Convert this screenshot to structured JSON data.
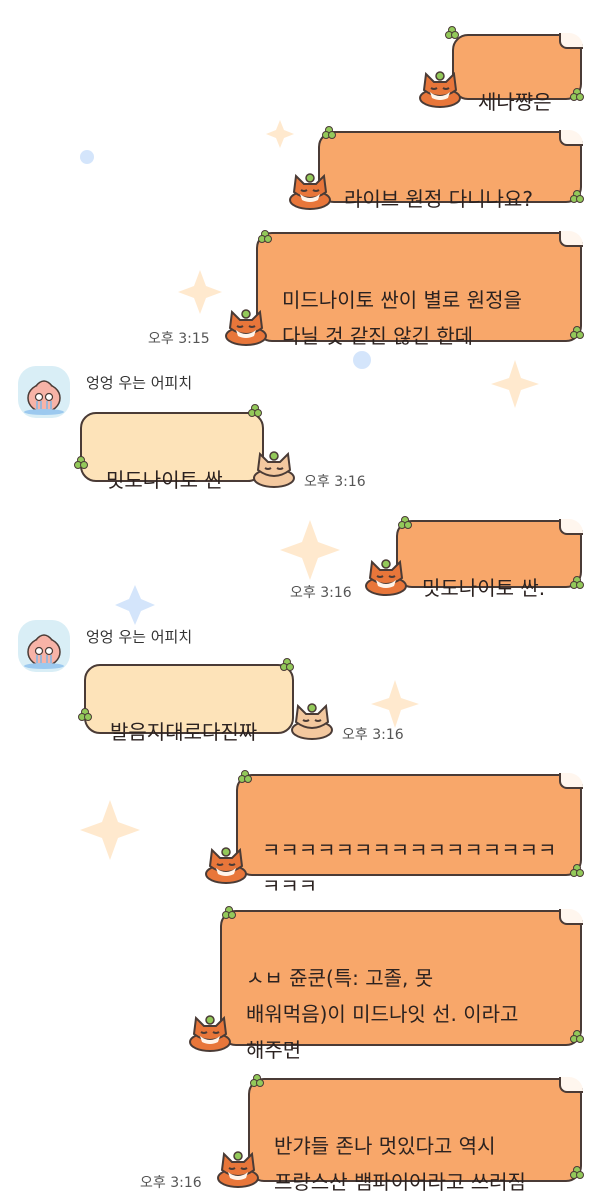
{
  "colors": {
    "outgoing_bubble": "#f8a76a",
    "incoming_bubble": "#fde3b9",
    "bubble_border": "#4a3b36",
    "clover": "#93c95a",
    "background": "#ffffff"
  },
  "messages": [
    {
      "id": "m1",
      "direction": "out",
      "text": "세나쨩은",
      "time": ""
    },
    {
      "id": "m2",
      "direction": "out",
      "text": "라이브 원정 다니나요?",
      "time": ""
    },
    {
      "id": "m3",
      "direction": "out",
      "text": "미드나이토 싼이 별로 원정을\n다닐 것 같진 않긴 한데",
      "time": "오후 3:15"
    },
    {
      "id": "m4",
      "direction": "in",
      "sender": "엉엉 우는 어피치",
      "text": "밋도나이토 싼",
      "time": "오후 3:16"
    },
    {
      "id": "m5",
      "direction": "out",
      "text": "밋도나이토 싼.",
      "time": "오후 3:16"
    },
    {
      "id": "m6",
      "direction": "in",
      "sender": "엉엉 우는 어피치",
      "text": "발음지대로다진짜",
      "time": "오후 3:16"
    },
    {
      "id": "m7",
      "direction": "out",
      "text": "ㅋㅋㅋㅋㅋㅋㅋㅋㅋㅋㅋㅋㅋㅋㅋㅋ\nㅋㅋㅋ",
      "time": ""
    },
    {
      "id": "m8",
      "direction": "out",
      "text": "ㅅㅂ 쥰쿤(특: 고졸, 못\n배워먹음)이 미드나잇 선. 이라고\n해주면",
      "time": ""
    },
    {
      "id": "m9",
      "direction": "out",
      "text": "반갸들 존나 멋있다고 역시\n프랑스산 뱀파이어라고 쓰러짐",
      "time": "오후 3:16"
    }
  ],
  "icons": {
    "avatar": "crying-apeach-avatar-icon",
    "bubble_decoration": "fox-with-clover-icon"
  }
}
